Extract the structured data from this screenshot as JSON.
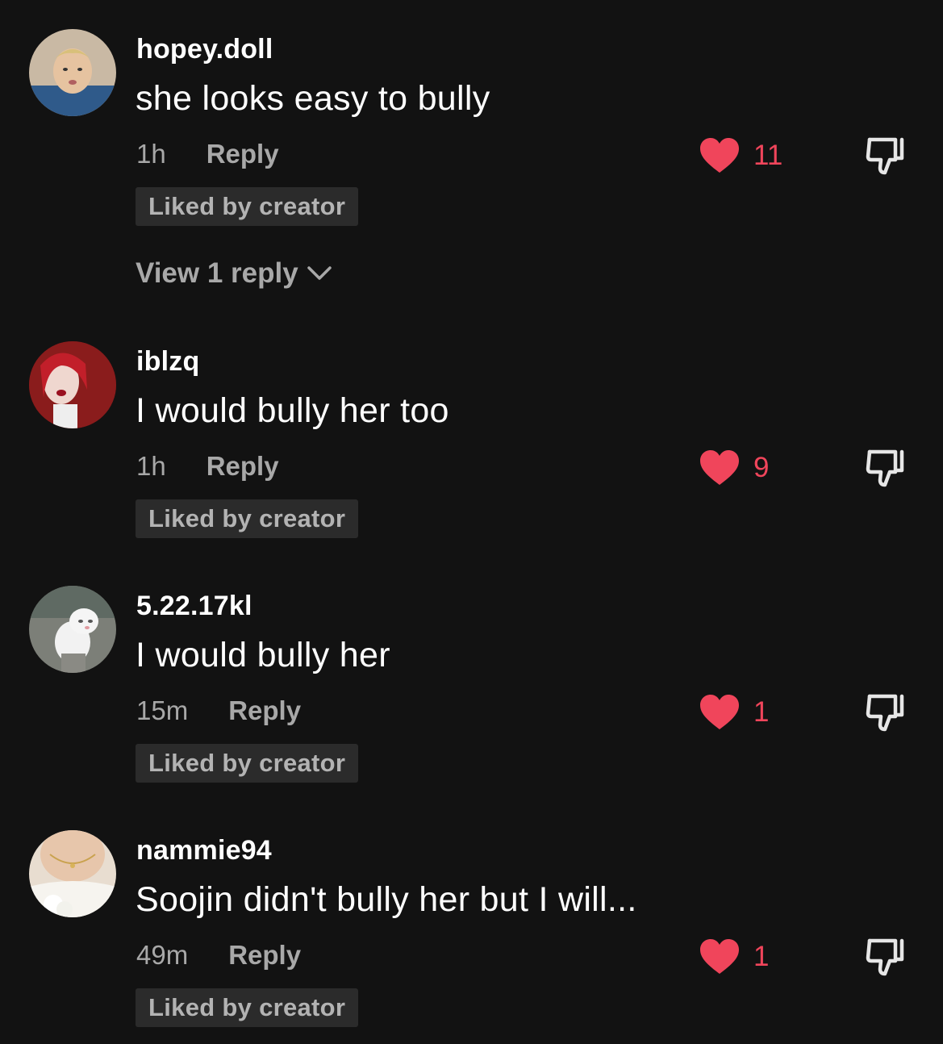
{
  "comments": [
    {
      "username": "hopey.doll",
      "text": "she looks easy to bully",
      "time": "1h",
      "reply_label": "Reply",
      "likes": "11",
      "badge": "Liked by creator",
      "view_replies": "View 1 reply",
      "avatar_icon": "avatar-photo-person"
    },
    {
      "username": "iblzq",
      "text": "I would bully her too",
      "time": "1h",
      "reply_label": "Reply",
      "likes": "9",
      "badge": "Liked by creator",
      "avatar_icon": "avatar-photo-red-hair"
    },
    {
      "username": "5.22.17kl",
      "text": "I would bully her",
      "time": "15m",
      "reply_label": "Reply",
      "likes": "1",
      "badge": "Liked by creator",
      "avatar_icon": "avatar-photo-cat"
    },
    {
      "username": "nammie94",
      "text": "Soojin didn't bully her but I will...",
      "time": "49m",
      "reply_label": "Reply",
      "likes": "1",
      "badge": "Liked by creator",
      "avatar_icon": "avatar-photo-necklace"
    }
  ],
  "icons": {
    "like": "heart-icon",
    "dislike": "thumbs-down-icon",
    "expand": "chevron-down-icon"
  },
  "colors": {
    "background": "#121212",
    "like_accent": "#f0455b",
    "secondary_text": "#a8a8a8",
    "badge_background": "#2b2b2b"
  }
}
